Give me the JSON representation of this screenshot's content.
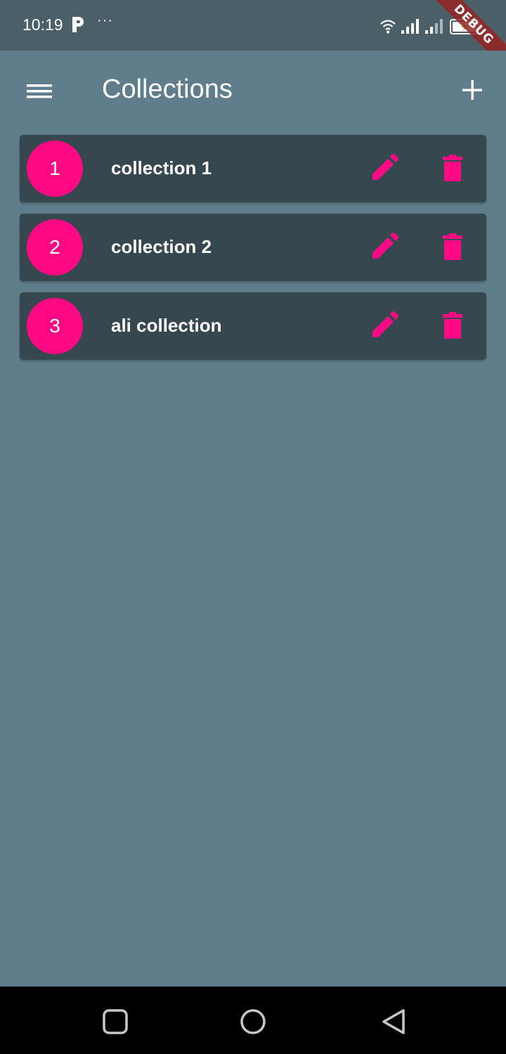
{
  "status_bar": {
    "time": "10:19",
    "more_indicator": "···",
    "icons": [
      "parking-icon",
      "wifi-icon",
      "signal-icon",
      "signal-icon",
      "battery-charging-icon"
    ]
  },
  "debug_banner": "DEBUG",
  "app_bar": {
    "title": "Collections",
    "menu_icon": "hamburger-menu-icon",
    "add_icon": "plus-icon"
  },
  "collections": [
    {
      "index": "1",
      "name": "collection 1"
    },
    {
      "index": "2",
      "name": "collection 2"
    },
    {
      "index": "3",
      "name": "ali collection"
    }
  ],
  "row_actions": [
    "pencil-icon",
    "trash-icon"
  ],
  "nav_bar": {
    "icons": [
      "recents-icon",
      "home-icon",
      "back-icon"
    ]
  },
  "colors": {
    "background": "#607d8b",
    "status_bar": "#4b5f69",
    "card": "#37474f",
    "accent": "#ff0a84",
    "nav_bar": "#000000"
  }
}
